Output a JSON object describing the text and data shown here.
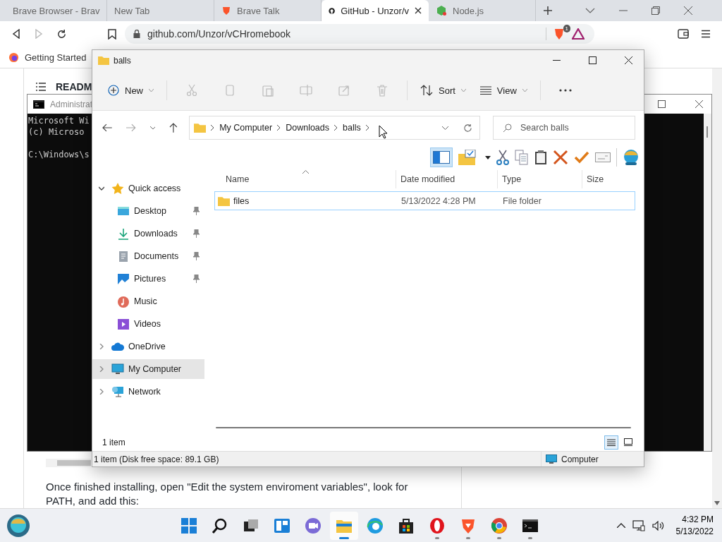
{
  "browser": {
    "tabs": [
      {
        "title": "Brave Browser - Brav",
        "selected": false
      },
      {
        "title": "New Tab",
        "selected": false
      },
      {
        "title": "Brave Talk",
        "selected": false
      },
      {
        "title": "GitHub - Unzor/v",
        "selected": true
      },
      {
        "title": "Node.js",
        "selected": false
      }
    ],
    "forward_disabled": true,
    "address": "github.com/Unzor/vCHromebook",
    "shield_badge": "1",
    "bookmark": "Getting Started",
    "page": {
      "heading": "READM",
      "paragraph": "Once finished installing, open \"Edit the system enviroment variables\", look for PATH, and add this:"
    }
  },
  "console": {
    "title": "Administrat",
    "lines": [
      "Microsoft Wi",
      "(c) Microso",
      "C:\\Windows\\s"
    ]
  },
  "explorer": {
    "title": "balls",
    "command_bar": {
      "new": "New",
      "actions": [
        {
          "disabled": true
        },
        {
          "disabled": true
        },
        {
          "disabled": true
        },
        {
          "disabled": true
        },
        {
          "disabled": true
        },
        {
          "disabled": true
        }
      ],
      "sort": "Sort",
      "view": "View"
    },
    "path": [
      "My Computer",
      "Downloads",
      "balls"
    ],
    "search": {
      "placeholder": "Search balls"
    },
    "preview_pane_on": true,
    "nav": [
      {
        "label": "Quick access",
        "expanded": true,
        "selected": false,
        "children": [
          {
            "label": "Desktop",
            "pinned": true,
            "selected": false
          },
          {
            "label": "Downloads",
            "pinned": true,
            "selected": false
          },
          {
            "label": "Documents",
            "pinned": true,
            "selected": false
          },
          {
            "label": "Pictures",
            "pinned": true,
            "selected": false
          },
          {
            "label": "Music",
            "pinned": false,
            "selected": false
          },
          {
            "label": "Videos",
            "pinned": false,
            "selected": false
          }
        ]
      },
      {
        "label": "OneDrive",
        "expanded": false,
        "selected": false
      },
      {
        "label": "My Computer",
        "expanded": false,
        "selected": true
      },
      {
        "label": "Network",
        "expanded": false,
        "selected": false
      }
    ],
    "columns": [
      {
        "label": "Name",
        "sorted": true
      },
      {
        "label": "Date modified",
        "sorted": false
      },
      {
        "label": "Type",
        "sorted": false
      },
      {
        "label": "Size",
        "sorted": false
      }
    ],
    "rows": [
      {
        "name": "files",
        "date": "5/13/2022 4:28 PM",
        "type": "File folder",
        "focused": true
      }
    ],
    "item_count": "1 item",
    "views": [
      {
        "selected": true
      },
      {
        "selected": false
      }
    ],
    "status": "1 item (Disk free space: 89.1 GB)",
    "location": "Computer"
  },
  "taskbar": {
    "apps": [
      {
        "running": false,
        "active": false
      },
      {
        "running": false,
        "active": false
      },
      {
        "running": false,
        "active": false
      },
      {
        "running": false,
        "active": false
      },
      {
        "running": false,
        "active": false
      },
      {
        "running": true,
        "active": true
      },
      {
        "running": false,
        "active": false
      },
      {
        "running": false,
        "active": false
      },
      {
        "running": true,
        "active": false
      },
      {
        "running": true,
        "active": false
      },
      {
        "running": true,
        "active": false
      },
      {
        "running": true,
        "active": false
      }
    ],
    "time": "4:32 PM",
    "date": "5/13/2022"
  }
}
